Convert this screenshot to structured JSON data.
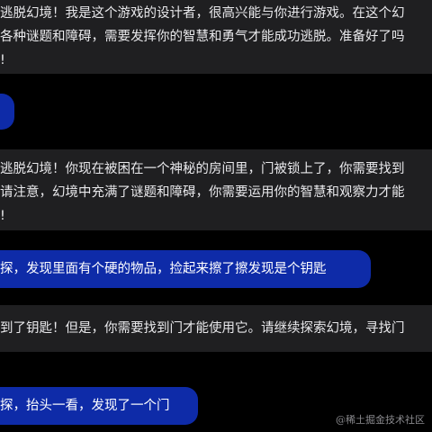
{
  "messages": [
    {
      "role": "assistant",
      "lines": [
        "逃脱幻境！我是这个游戏的设计者，很高兴能与你进行游戏。在这个幻",
        "各种谜题和障碍，需要发挥你的智慧和勇气才能成功逃脱。准备好了吗",
        "!"
      ]
    },
    {
      "role": "user",
      "text": ""
    },
    {
      "role": "assistant",
      "lines": [
        "逃脱幻境！你现在被困在一个神秘的房间里，门被锁上了，你需要找到",
        "请注意，幻境中充满了谜题和障碍，你需要运用你的智慧和观察力才能",
        "!"
      ]
    },
    {
      "role": "user",
      "text": "探，发现里面有个硬的物品，捡起来擦了擦发现是个钥匙"
    },
    {
      "role": "assistant",
      "lines": [
        "到了钥匙！但是，你需要找到门才能使用它。请继续探索幻境，寻找门"
      ]
    },
    {
      "role": "user",
      "text": "探，抬头一看，发现了一个门"
    }
  ],
  "watermark": "@稀土掘金技术社区",
  "colors": {
    "background": "#000000",
    "assistant_bubble": "#1f1f21",
    "user_bubble": "#0e2ba8",
    "text": "#e9e9ec"
  }
}
